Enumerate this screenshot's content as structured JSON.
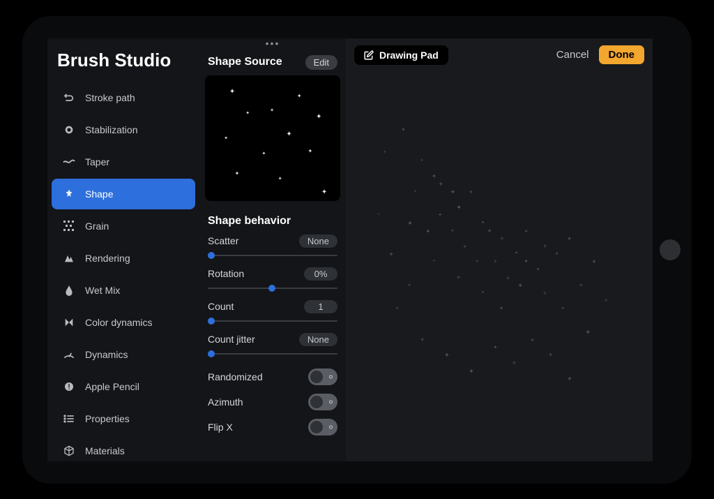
{
  "app": {
    "title": "Brush Studio"
  },
  "sidebar": {
    "items": [
      {
        "label": "Stroke path",
        "icon": "stroke-path",
        "active": false
      },
      {
        "label": "Stabilization",
        "icon": "stabilization",
        "active": false
      },
      {
        "label": "Taper",
        "icon": "taper",
        "active": false
      },
      {
        "label": "Shape",
        "icon": "shape",
        "active": true
      },
      {
        "label": "Grain",
        "icon": "grain",
        "active": false
      },
      {
        "label": "Rendering",
        "icon": "rendering",
        "active": false
      },
      {
        "label": "Wet Mix",
        "icon": "wetmix",
        "active": false
      },
      {
        "label": "Color dynamics",
        "icon": "colordynamics",
        "active": false
      },
      {
        "label": "Dynamics",
        "icon": "dynamics",
        "active": false
      },
      {
        "label": "Apple Pencil",
        "icon": "applepencil",
        "active": false
      },
      {
        "label": "Properties",
        "icon": "properties",
        "active": false
      },
      {
        "label": "Materials",
        "icon": "materials",
        "active": false
      }
    ]
  },
  "shape_source": {
    "title": "Shape Source",
    "edit_label": "Edit"
  },
  "shape_behavior": {
    "title": "Shape behavior",
    "sliders": [
      {
        "label": "Scatter",
        "value": "None",
        "thumb_pct": 0
      },
      {
        "label": "Rotation",
        "value": "0%",
        "thumb_pct": 47
      },
      {
        "label": "Count",
        "value": "1",
        "thumb_pct": 0
      },
      {
        "label": "Count jitter",
        "value": "None",
        "thumb_pct": 0
      }
    ],
    "toggles": [
      {
        "label": "Randomized",
        "on": false
      },
      {
        "label": "Azimuth",
        "on": false
      },
      {
        "label": "Flip X",
        "on": false
      }
    ]
  },
  "drawing_pad": {
    "label": "Drawing Pad",
    "cancel_label": "Cancel",
    "done_label": "Done"
  },
  "colors": {
    "accent": "#2d6fdc",
    "done": "#f3a72e"
  }
}
